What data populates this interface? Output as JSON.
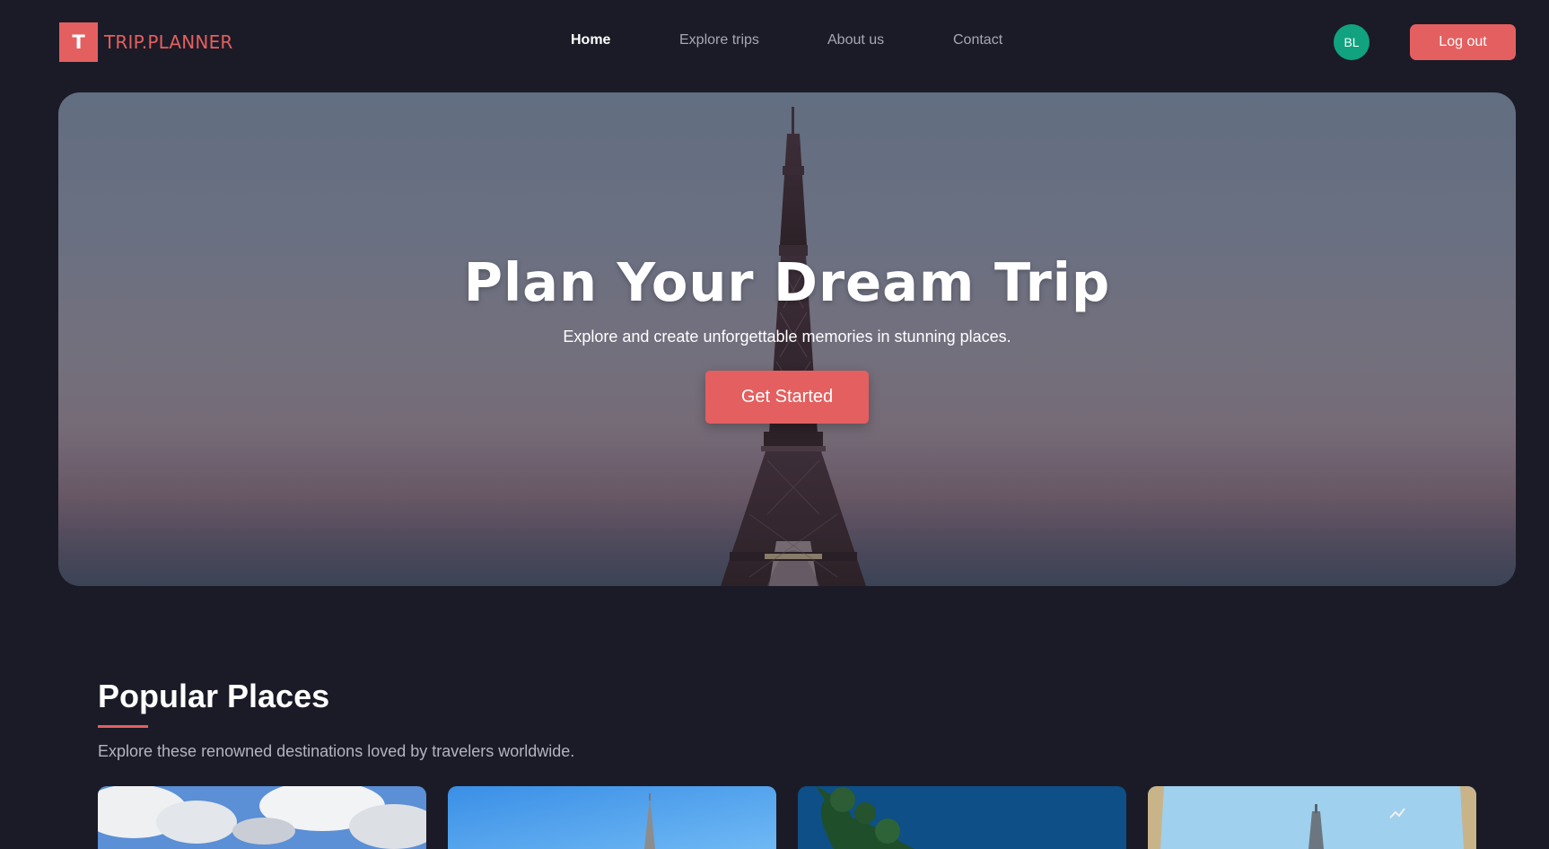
{
  "brand": {
    "logo_letter": "T",
    "name": "TRIP.PLANNER",
    "color": "#e45f5f"
  },
  "nav": {
    "links": [
      {
        "label": "Home",
        "active": true
      },
      {
        "label": "Explore trips",
        "active": false
      },
      {
        "label": "About us",
        "active": false
      },
      {
        "label": "Contact",
        "active": false
      }
    ],
    "avatar_initials": "BL",
    "avatar_color": "#11a27f",
    "logout_label": "Log out"
  },
  "hero": {
    "title": "Plan Your Dream Trip",
    "subtitle": "Explore and create unforgettable memories in stunning places.",
    "cta_label": "Get Started"
  },
  "popular": {
    "title": "Popular Places",
    "subtitle": "Explore these renowned destinations loved by travelers worldwide.",
    "cards": [
      "cloudy-sky-photo",
      "church-spire-photo",
      "tree-blue-sky-photo",
      "tower-bird-photo"
    ]
  },
  "colors": {
    "background": "#1b1b27",
    "accent": "#e45f5f",
    "muted_text": "#a7a7b5"
  }
}
